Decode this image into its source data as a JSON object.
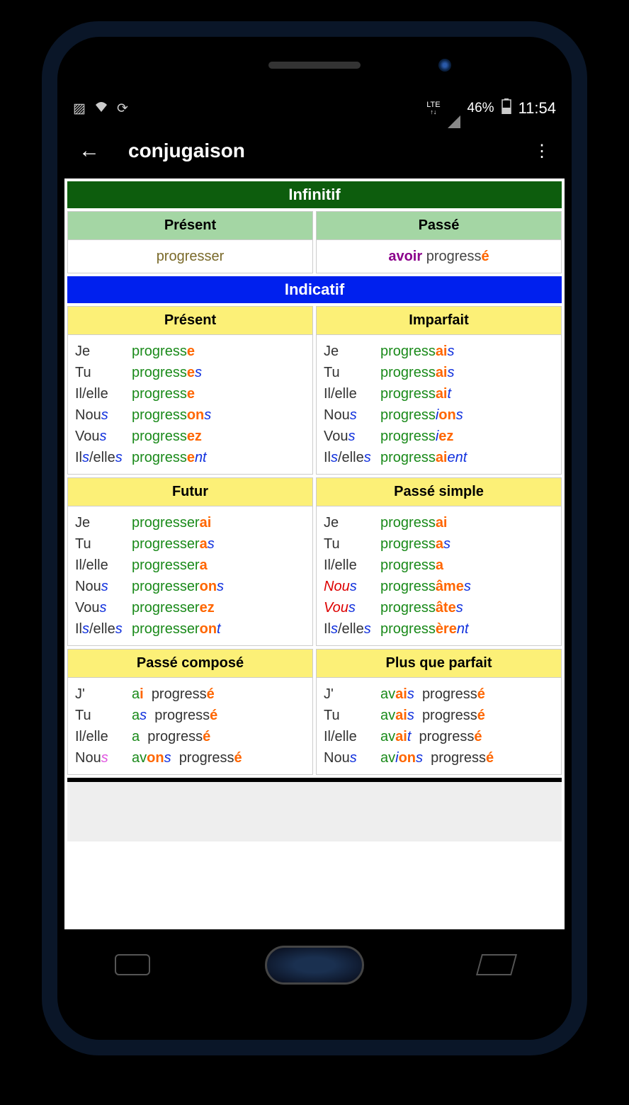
{
  "status": {
    "lte": "LTE",
    "battery": "46%",
    "time": "11:54"
  },
  "appbar": {
    "title": "conjugaison"
  },
  "moods": {
    "infinitif": "Infinitif",
    "indicatif": "Indicatif"
  },
  "infinitif": {
    "present_label": "Présent",
    "passe_label": "Passé",
    "present_value": "progresser",
    "passe_aux": "avoir",
    "passe_pp_stem": "progress",
    "passe_pp_end": "é"
  },
  "indicatif": {
    "present": {
      "label": "Présent",
      "rows": [
        {
          "p": "Je",
          "stem": "progress",
          "end_o": "e"
        },
        {
          "p": "Tu",
          "stem": "progress",
          "end_o": "e",
          "end_b": "s"
        },
        {
          "p": "Il/elle",
          "stem": "progress",
          "end_o": "e"
        },
        {
          "p_stem": "Nou",
          "p_s": "s",
          "stem": "progress",
          "end_o": "on",
          "end_b": "s"
        },
        {
          "p_stem": "Vou",
          "p_s": "s",
          "stem": "progress",
          "end_o": "ez"
        },
        {
          "p_stem": "Il",
          "p_s": "s",
          "p_rest": "/elle",
          "p_s2": "s",
          "stem": "progress",
          "end_o": "e",
          "end_b": "nt"
        }
      ]
    },
    "imparfait": {
      "label": "Imparfait",
      "rows": [
        {
          "p": "Je",
          "stem": "progress",
          "end_o": "ai",
          "end_b": "s"
        },
        {
          "p": "Tu",
          "stem": "progress",
          "end_o": "ai",
          "end_b": "s"
        },
        {
          "p": "Il/elle",
          "stem": "progress",
          "end_o": "ai",
          "end_b": "t"
        },
        {
          "p_stem": "Nou",
          "p_s": "s",
          "stem": "progress",
          "mid_b": "i",
          "end_o": "on",
          "end_b": "s"
        },
        {
          "p_stem": "Vou",
          "p_s": "s",
          "stem": "progress",
          "mid_b": "i",
          "end_o": "ez"
        },
        {
          "p_stem": "Il",
          "p_s": "s",
          "p_rest": "/elle",
          "p_s2": "s",
          "stem": "progress",
          "end_o": "ai",
          "end_b": "ent"
        }
      ]
    },
    "futur": {
      "label": "Futur",
      "rows": [
        {
          "p": "Je",
          "stem": "progresser",
          "end_o": "ai"
        },
        {
          "p": "Tu",
          "stem": "progresser",
          "end_o": "a",
          "end_b": "s"
        },
        {
          "p": "Il/elle",
          "stem": "progresser",
          "end_o": "a"
        },
        {
          "p_stem": "Nou",
          "p_s": "s",
          "stem": "progresser",
          "end_o": "on",
          "end_b": "s"
        },
        {
          "p_stem": "Vou",
          "p_s": "s",
          "stem": "progresser",
          "end_o": "ez"
        },
        {
          "p_stem": "Il",
          "p_s": "s",
          "p_rest": "/elle",
          "p_s2": "s",
          "stem": "progresser",
          "end_o": "on",
          "end_b": "t"
        }
      ]
    },
    "passe_simple": {
      "label": "Passé simple",
      "rows": [
        {
          "p": "Je",
          "stem": "progress",
          "end_o": "ai"
        },
        {
          "p": "Tu",
          "stem": "progress",
          "end_o": "a",
          "end_b": "s"
        },
        {
          "p": "Il/elle",
          "stem": "progress",
          "end_o": "a"
        },
        {
          "p_red": "Nou",
          "p_s": "s",
          "stem": "progress",
          "end_o": "âme",
          "end_b": "s"
        },
        {
          "p_red": "Vou",
          "p_s": "s",
          "stem": "progress",
          "end_o": "âte",
          "end_b": "s"
        },
        {
          "p_stem": "Il",
          "p_s": "s",
          "p_rest": "/elle",
          "p_s2": "s",
          "stem": "progress",
          "end_o": "ère",
          "end_b": "nt"
        }
      ]
    },
    "passe_compose": {
      "label": "Passé composé",
      "rows": [
        {
          "p": "J'",
          "aux_stem": "a",
          "aux_end": "i",
          "pp": "progress",
          "pp_end": "é"
        },
        {
          "p": "Tu",
          "aux_stem": "a",
          "aux_end_b": "s",
          "pp": "progress",
          "pp_end": "é"
        },
        {
          "p": "Il/elle",
          "aux_stem": "a",
          "pp": "progress",
          "pp_end": "é"
        },
        {
          "p_stem": "Nou",
          "p_s_pink": "s",
          "aux_stem": "av",
          "aux_end": "on",
          "aux_end_b": "s",
          "pp": "progress",
          "pp_end": "é"
        }
      ]
    },
    "plus_que_parfait": {
      "label": "Plus que parfait",
      "rows": [
        {
          "p": "J'",
          "aux_stem": "av",
          "aux_end": "ai",
          "aux_end_b": "s",
          "pp": "progress",
          "pp_end": "é"
        },
        {
          "p": "Tu",
          "aux_stem": "av",
          "aux_end": "ai",
          "aux_end_b": "s",
          "pp": "progress",
          "pp_end": "é"
        },
        {
          "p": "Il/elle",
          "aux_stem": "av",
          "aux_end": "ai",
          "aux_end_b": "t",
          "pp": "progress",
          "pp_end": "é"
        },
        {
          "p_stem": "Nou",
          "p_s": "s",
          "aux_stem": "av",
          "aux_mid_b": "i",
          "aux_end": "on",
          "aux_end_b": "s",
          "pp": "progress",
          "pp_end": "é"
        }
      ]
    }
  }
}
